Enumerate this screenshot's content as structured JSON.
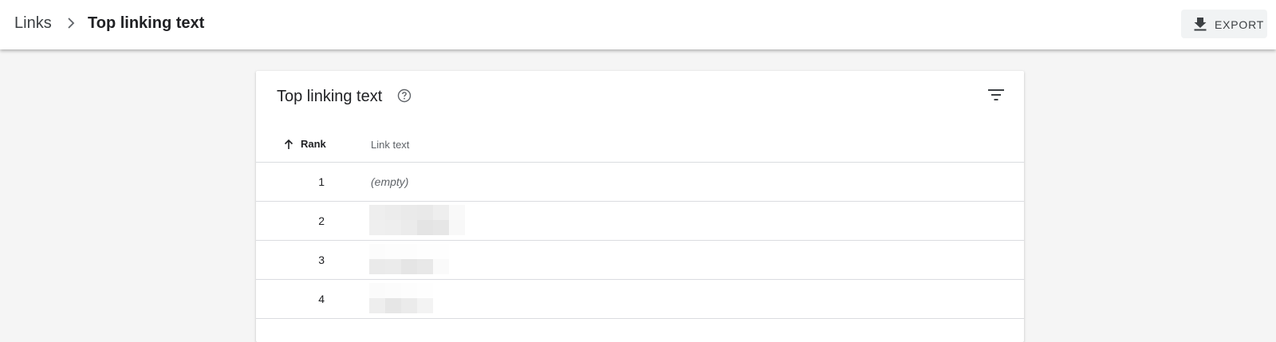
{
  "header": {
    "breadcrumb_root": "Links",
    "breadcrumb_current": "Top linking text",
    "export_label": "EXPORT"
  },
  "card": {
    "title": "Top linking text"
  },
  "table": {
    "columns": {
      "rank": "Rank",
      "link_text": "Link text"
    },
    "sort": {
      "column": "rank",
      "direction": "ascending"
    },
    "rows": [
      {
        "rank": "1",
        "link_text": "(empty)"
      },
      {
        "rank": "2",
        "link_text": "",
        "redacted": true
      },
      {
        "rank": "3",
        "link_text": "",
        "redacted": true
      },
      {
        "rank": "4",
        "link_text": "",
        "redacted": true
      }
    ]
  },
  "icons": {
    "breadcrumb_separator": "chevron-right-icon",
    "export": "download-icon",
    "help": "help-circle-icon",
    "filter": "filter-icon",
    "sort": "arrow-up-icon"
  },
  "colors": {
    "page_background": "#f5f5f5",
    "divider": "#dadce0",
    "muted_text": "#5f6368"
  }
}
